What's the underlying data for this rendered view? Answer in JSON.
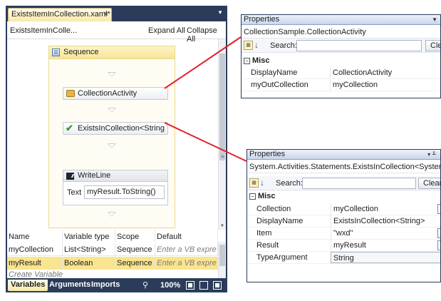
{
  "designer": {
    "tab_title": "ExistsItemInCollection.xaml*",
    "tab_close": "×",
    "window_menu_glyph": "▼",
    "breadcrumb": "ExistsItemInColle...",
    "expand_all": "Expand All",
    "collapse_all": "Collapse All",
    "sequence_label": "Sequence",
    "activities": {
      "collection_activity": "CollectionActivity",
      "exists_in_collection": "ExistsInCollection<String",
      "writeline": "WriteLine",
      "writeline_text_label": "Text",
      "writeline_text_value": "myResult.ToString()"
    }
  },
  "variables": {
    "headers": [
      "Name",
      "Variable type",
      "Scope",
      "Default"
    ],
    "rows": [
      {
        "name": "myCollection",
        "type": "List<String>",
        "scope": "Sequence",
        "default": "Enter a VB expre"
      },
      {
        "name": "myResult",
        "type": "Boolean",
        "scope": "Sequence",
        "default": "Enter a VB expre"
      }
    ],
    "create_label": "Create Variable"
  },
  "bottom_bar": {
    "tabs": [
      "Variables",
      "Arguments",
      "Imports"
    ],
    "zoom": "100%"
  },
  "properties_top": {
    "title": "Properties",
    "type_name": "CollectionSample.CollectionActivity",
    "search_label": "Search:",
    "clear_label": "Cle",
    "category": "Misc",
    "rows": [
      {
        "name": "DisplayName",
        "value": "CollectionActivity"
      },
      {
        "name": "myOutCollection",
        "value": "myCollection"
      }
    ]
  },
  "properties_bottom": {
    "title": "Properties",
    "pin_glyph": "▾ ╨",
    "type_name": "System.Activities.Statements.ExistsInCollection<System.String>",
    "search_label": "Search:",
    "clear_label": "Clear",
    "category": "Misc",
    "rows": [
      {
        "name": "Collection",
        "value": "myCollection"
      },
      {
        "name": "DisplayName",
        "value": "ExistsInCollection<String>"
      },
      {
        "name": "Item",
        "value": "\"wxd\""
      },
      {
        "name": "Result",
        "value": "myResult"
      },
      {
        "name": "TypeArgument",
        "value": "String"
      }
    ]
  },
  "colors": {
    "chrome": "#2b3c5a",
    "connector": "#e0202a",
    "selection": "#f9e48f"
  }
}
